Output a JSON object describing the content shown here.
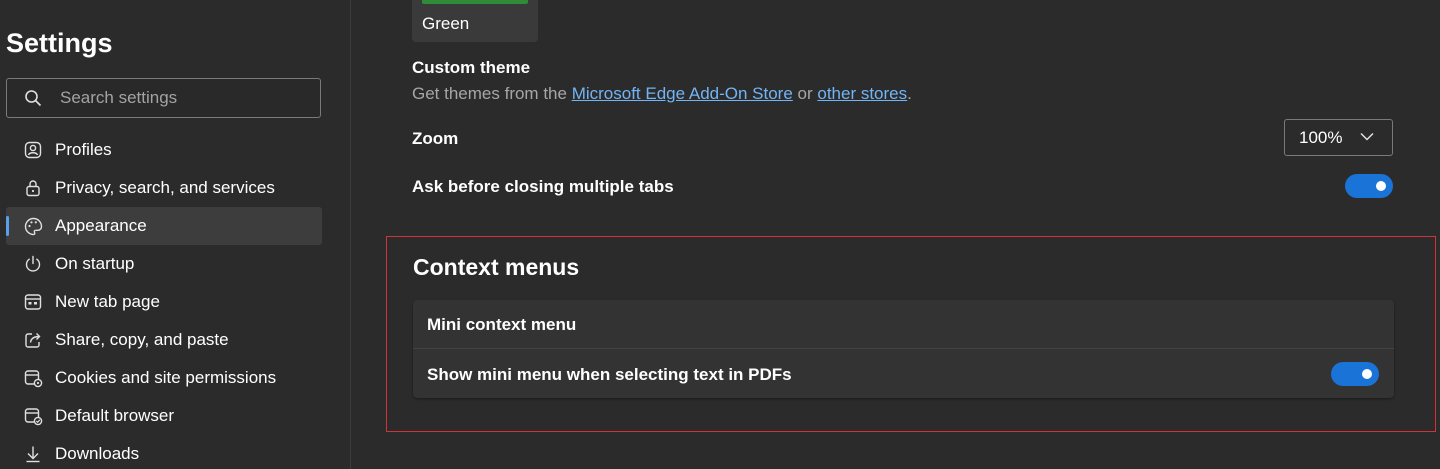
{
  "sidebar": {
    "title": "Settings",
    "search": {
      "placeholder": "Search settings",
      "value": ""
    },
    "items": [
      {
        "label": "Profiles",
        "icon": "profile-icon",
        "active": false
      },
      {
        "label": "Privacy, search, and services",
        "icon": "lock-icon",
        "active": false
      },
      {
        "label": "Appearance",
        "icon": "palette-icon",
        "active": true
      },
      {
        "label": "On startup",
        "icon": "power-icon",
        "active": false
      },
      {
        "label": "New tab page",
        "icon": "new-tab-icon",
        "active": false
      },
      {
        "label": "Share, copy, and paste",
        "icon": "share-icon",
        "active": false
      },
      {
        "label": "Cookies and site permissions",
        "icon": "cookies-icon",
        "active": false
      },
      {
        "label": "Default browser",
        "icon": "browser-icon",
        "active": false
      },
      {
        "label": "Downloads",
        "icon": "download-icon",
        "active": false
      }
    ],
    "accent_color": "#5aa0e8"
  },
  "main": {
    "theme_card": {
      "name": "Green",
      "color": "#2f8a3a"
    },
    "custom_theme": {
      "title": "Custom theme",
      "desc_prefix": "Get themes from the ",
      "link1": "Microsoft Edge Add-On Store",
      "desc_middle": " or ",
      "link2": "other stores",
      "desc_suffix": "."
    },
    "zoom": {
      "label": "Zoom",
      "value": "100%"
    },
    "ask_before_closing": {
      "label": "Ask before closing multiple tabs",
      "enabled": true
    },
    "context_menus": {
      "title": "Context menus",
      "card_header": "Mini context menu",
      "show_mini_menu": {
        "label": "Show mini menu when selecting text in PDFs",
        "enabled": true
      },
      "highlight_color": "#d13438"
    },
    "toggle_color": "#1a73d6"
  }
}
